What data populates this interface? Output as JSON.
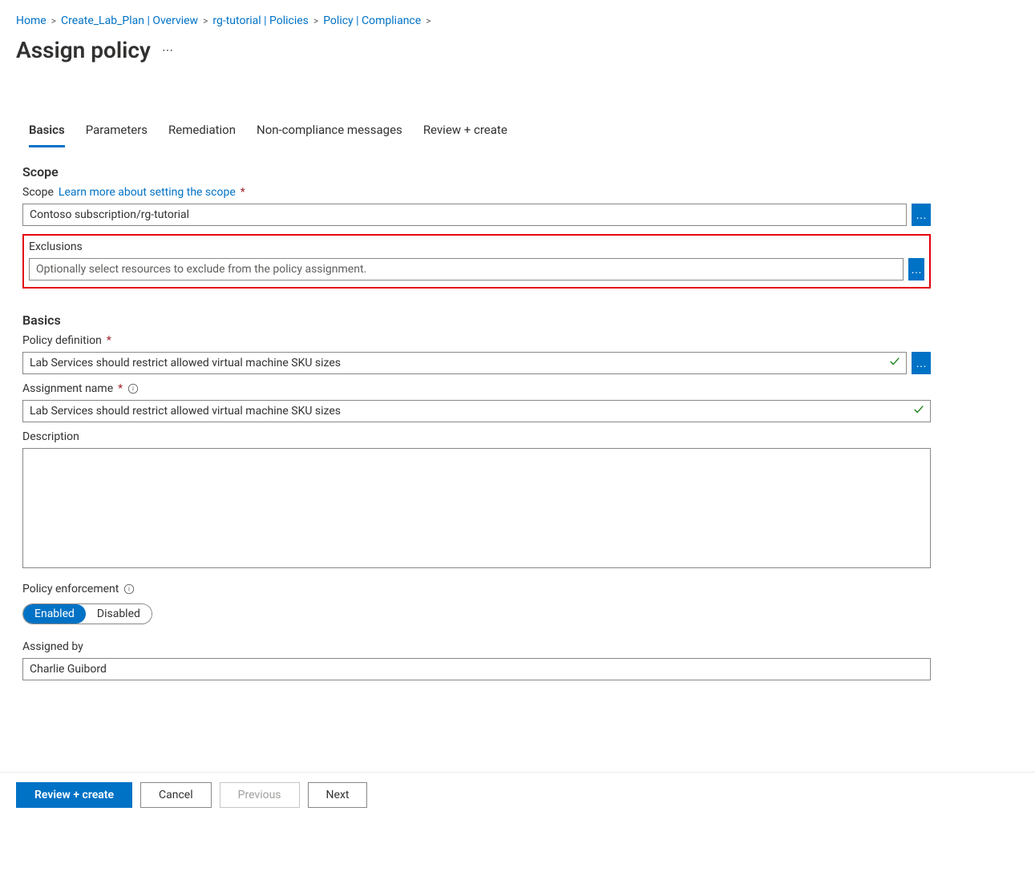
{
  "breadcrumb": {
    "items": [
      {
        "label": "Home"
      },
      {
        "label": "Create_Lab_Plan | Overview"
      },
      {
        "label": "rg-tutorial | Policies"
      },
      {
        "label": "Policy | Compliance"
      }
    ]
  },
  "page": {
    "title": "Assign policy"
  },
  "tabs": [
    {
      "label": "Basics",
      "active": true
    },
    {
      "label": "Parameters"
    },
    {
      "label": "Remediation"
    },
    {
      "label": "Non-compliance messages"
    },
    {
      "label": "Review + create"
    }
  ],
  "scope": {
    "section_title": "Scope",
    "label": "Scope",
    "link_text": "Learn more about setting the scope",
    "value": "Contoso subscription/rg-tutorial",
    "exclusions_label": "Exclusions",
    "exclusions_placeholder": "Optionally select resources to exclude from the policy assignment."
  },
  "basics": {
    "section_title": "Basics",
    "policy_definition_label": "Policy definition",
    "policy_definition_value": "Lab Services should restrict allowed virtual machine SKU sizes",
    "assignment_name_label": "Assignment name",
    "assignment_name_value": "Lab Services should restrict allowed virtual machine SKU sizes",
    "description_label": "Description",
    "description_value": "",
    "policy_enforcement_label": "Policy enforcement",
    "enforcement_enabled": "Enabled",
    "enforcement_disabled": "Disabled",
    "assigned_by_label": "Assigned by",
    "assigned_by_value": "Charlie Guibord"
  },
  "footer": {
    "review_create": "Review + create",
    "cancel": "Cancel",
    "previous": "Previous",
    "next": "Next"
  }
}
